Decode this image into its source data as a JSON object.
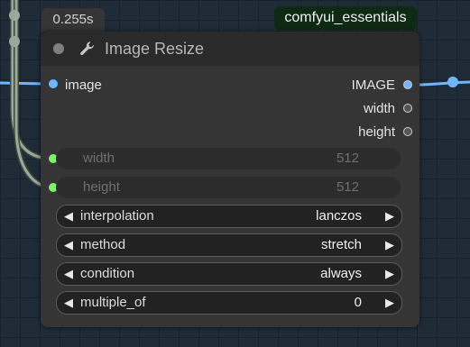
{
  "timing": "0.255s",
  "badge": "comfyui_essentials",
  "node": {
    "title": "Image Resize",
    "inputs": [
      "image"
    ],
    "outputs": [
      "IMAGE",
      "width",
      "height"
    ],
    "converted_widgets": [
      {
        "label": "width",
        "value": "512"
      },
      {
        "label": "height",
        "value": "512"
      }
    ],
    "widgets": [
      {
        "label": "interpolation",
        "value": "lanczos"
      },
      {
        "label": "method",
        "value": "stretch"
      },
      {
        "label": "condition",
        "value": "always"
      },
      {
        "label": "multiple_of",
        "value": "0"
      }
    ]
  },
  "colors": {
    "image_link": "#6fb6ff",
    "int_link": "#9aa99a",
    "int_slot": "#7cef6b",
    "canvas": "#1f2c38"
  },
  "icons": {
    "title": "wrench-icon",
    "decrement": "◀",
    "increment": "▶"
  }
}
